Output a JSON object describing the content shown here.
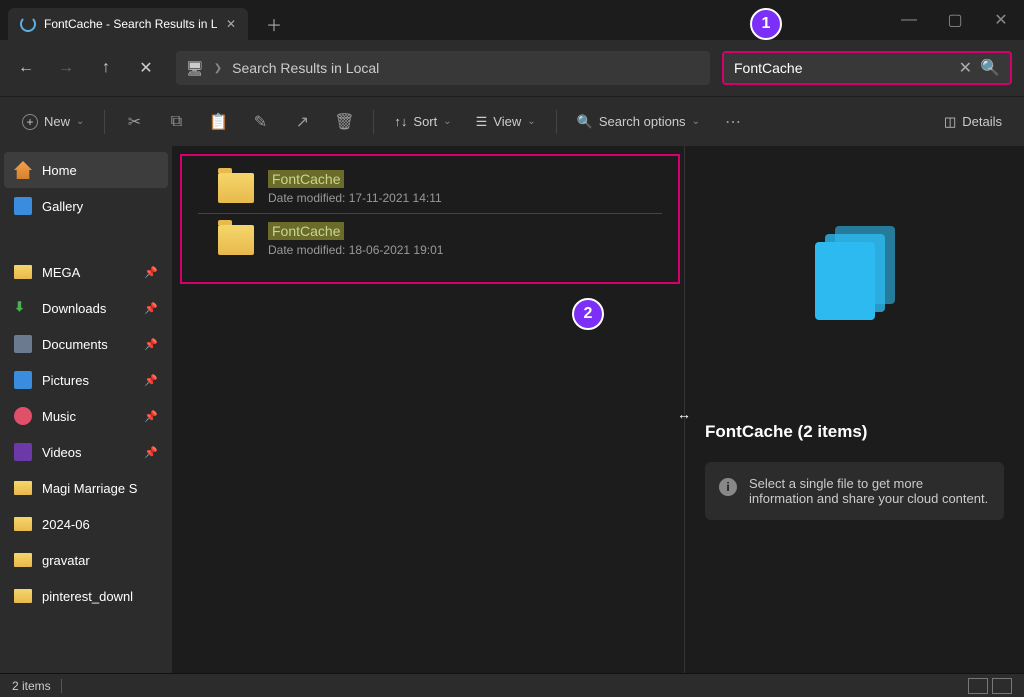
{
  "window": {
    "tab_title": "FontCache - Search Results in L"
  },
  "nav": {
    "address": "Search Results in Local"
  },
  "search": {
    "value": "FontCache"
  },
  "ribbon": {
    "new": "New",
    "sort": "Sort",
    "view": "View",
    "search_options": "Search options",
    "details": "Details"
  },
  "sidebar": {
    "home": "Home",
    "gallery": "Gallery",
    "items": [
      {
        "label": "MEGA",
        "pinned": true
      },
      {
        "label": "Downloads",
        "pinned": true
      },
      {
        "label": "Documents",
        "pinned": true
      },
      {
        "label": "Pictures",
        "pinned": true
      },
      {
        "label": "Music",
        "pinned": true
      },
      {
        "label": "Videos",
        "pinned": true
      },
      {
        "label": "Magi Marriage S",
        "pinned": false
      },
      {
        "label": "2024-06",
        "pinned": false
      },
      {
        "label": "gravatar",
        "pinned": false
      },
      {
        "label": "pinterest_downl",
        "pinned": false
      }
    ]
  },
  "results": [
    {
      "name": "FontCache",
      "meta": "Date modified: 17-11-2021 14:11"
    },
    {
      "name": "FontCache",
      "meta": "Date modified: 18-06-2021 19:01"
    }
  ],
  "preview": {
    "title": "FontCache (2 items)",
    "message": "Select a single file to get more information and share your cloud content."
  },
  "status": {
    "count": "2 items"
  },
  "annotations": {
    "a1": "1",
    "a2": "2"
  }
}
